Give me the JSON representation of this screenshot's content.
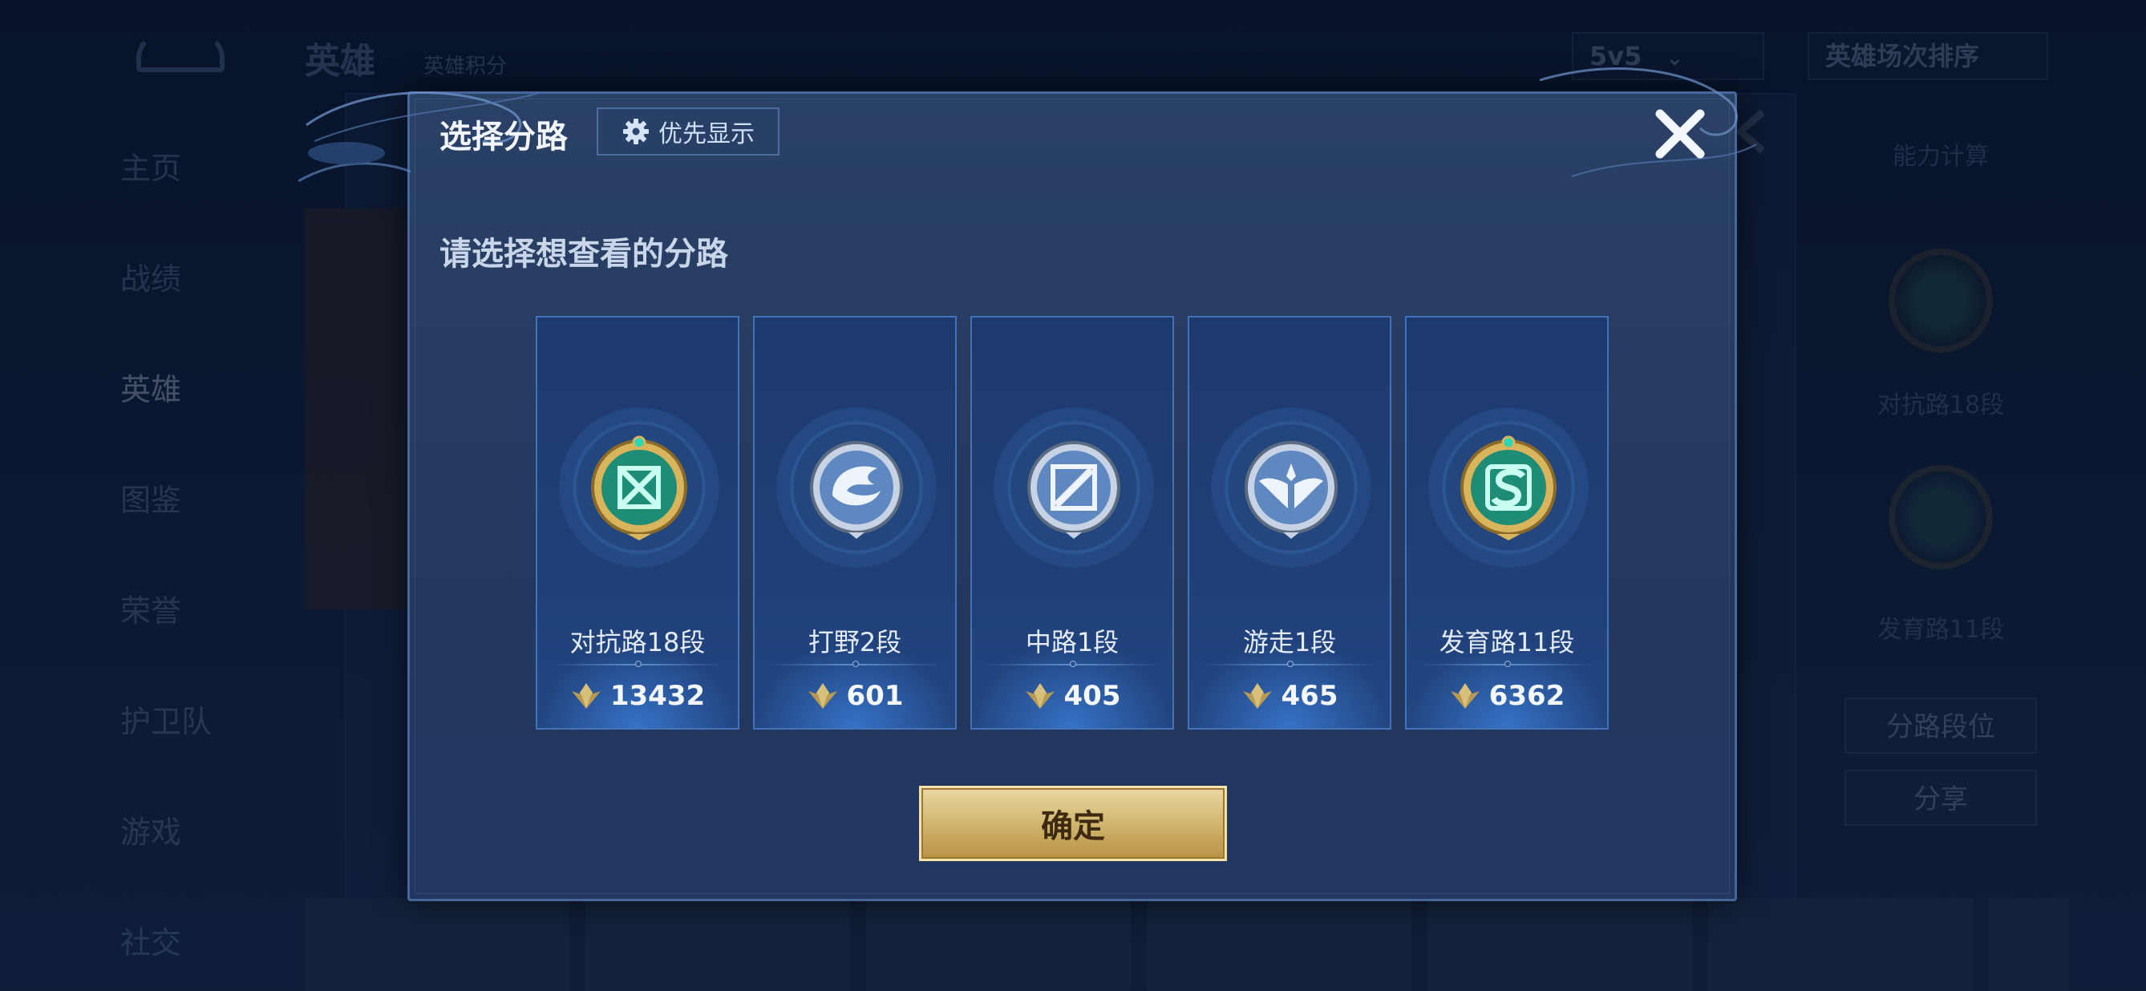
{
  "background": {
    "top_title": "英雄",
    "top_subtitle": "英雄积分",
    "mode_select": "5v5",
    "sort_select": "英雄场次排序",
    "nav_items": [
      "主页",
      "战绩",
      "英雄",
      "图鉴",
      "荣誉",
      "护卫队",
      "游戏",
      "社交"
    ],
    "right_labels": [
      "能力计算",
      "",
      "",
      "对抗路18段",
      "",
      "发育路11段"
    ],
    "right_buttons": [
      "分路段位",
      "分享"
    ]
  },
  "modal": {
    "title": "选择分路",
    "priority_label": "优先显示",
    "subtitle": "请选择想查看的分路",
    "confirm_label": "确定"
  },
  "lanes": [
    {
      "name": "对抗路18段",
      "score": "13432",
      "emblem": "clash-lane-emblem-gold",
      "accent": "#2fd6b4"
    },
    {
      "name": "打野2段",
      "score": "601",
      "emblem": "jungle-dragon-emblem-silver",
      "accent": "#8fb8e8"
    },
    {
      "name": "中路1段",
      "score": "405",
      "emblem": "mid-lane-emblem-silver",
      "accent": "#8fb8e8"
    },
    {
      "name": "游走1段",
      "score": "465",
      "emblem": "roam-wings-emblem-silver",
      "accent": "#8fb8e8"
    },
    {
      "name": "发育路11段",
      "score": "6362",
      "emblem": "farm-lane-emblem-gold",
      "accent": "#2fd6b4"
    }
  ],
  "colors": {
    "modal_bg": "#263c62",
    "card_bg": "#1f3f76",
    "card_border": "#4372b8",
    "confirm_gold": "#d2b66f",
    "text_primary": "#f2f6fc"
  }
}
